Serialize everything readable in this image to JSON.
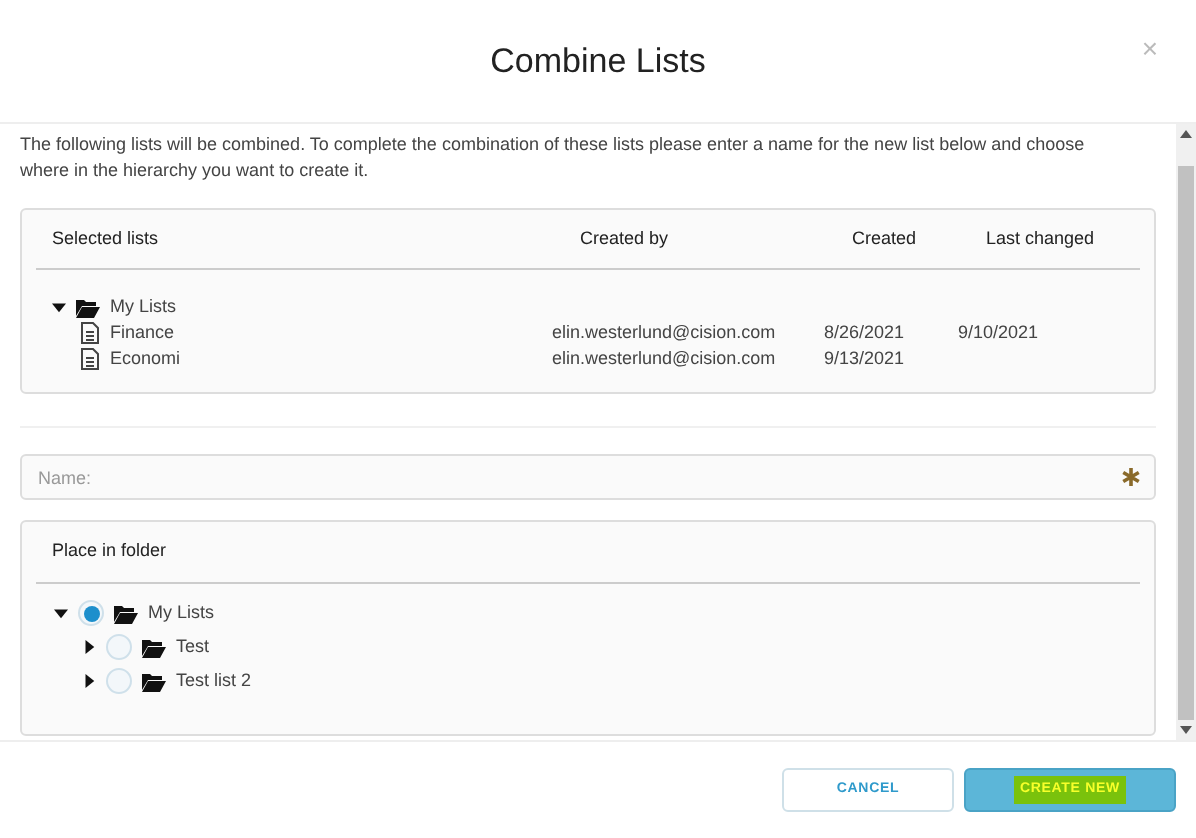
{
  "dialog": {
    "title": "Combine Lists",
    "close": "×"
  },
  "intro": "The following lists will be combined. To complete the combination of these lists please enter a name for the new list below and choose where in the hierarchy you want to create it.",
  "selected_lists": {
    "columns": [
      "Selected lists",
      "Created by",
      "Created",
      "Last changed"
    ],
    "tree": [
      {
        "name": "My Lists",
        "expanded": true,
        "children": [
          {
            "name": "Finance",
            "created_by": "elin.westerlund@cision.com",
            "created": "8/26/2021",
            "last_changed": "9/10/2021"
          },
          {
            "name": "Economi",
            "created_by": "elin.westerlund@cision.com",
            "created": "9/13/2021"
          }
        ]
      }
    ]
  },
  "name_field": {
    "placeholder": "Name:",
    "required": true
  },
  "place_in_folder": {
    "title": "Place in folder",
    "tree": [
      {
        "name": "My Lists",
        "expanded": true,
        "selected": true,
        "children": [
          {
            "name": "Test",
            "expanded": false,
            "selected": false
          },
          {
            "name": "Test list 2",
            "expanded": false,
            "selected": false
          }
        ]
      }
    ]
  },
  "buttons": [
    {
      "label": "CANCEL",
      "kind": "secondary",
      "highlighted": false
    },
    {
      "label": "CREATE NEW",
      "kind": "primary",
      "highlighted": true
    }
  ]
}
